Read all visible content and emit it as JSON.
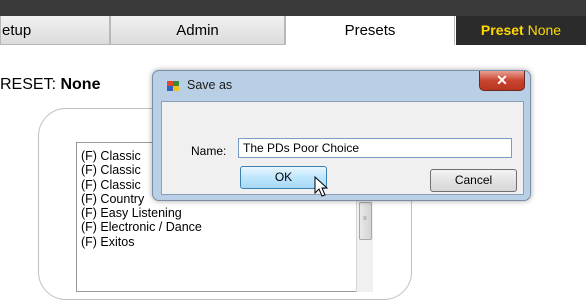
{
  "tabs": {
    "setup": "etup",
    "admin": "Admin",
    "presets": "Presets",
    "preset_indicator_bold": "Preset",
    "preset_indicator_value": "None"
  },
  "preset_label": {
    "prefix": "RESET:",
    "value": "None"
  },
  "genre_list": [
    "(F) Classic",
    "(F) Classic",
    "(F) Classic",
    "(F) Country",
    "(F) Easy Listening",
    "(F) Electronic / Dance",
    "(F) Exitos"
  ],
  "dialog": {
    "title": "Save as",
    "close_glyph": "✕",
    "name_label": "Name:",
    "name_value": "The PDs Poor Choice",
    "ok_label": "OK",
    "cancel_label": "Cancel"
  },
  "colors": {
    "header_bg": "#3a3a3a",
    "preset_indicator_text": "#ffd900",
    "dialog_frame": "#b9cfe6",
    "close_button": "#c9452f"
  }
}
